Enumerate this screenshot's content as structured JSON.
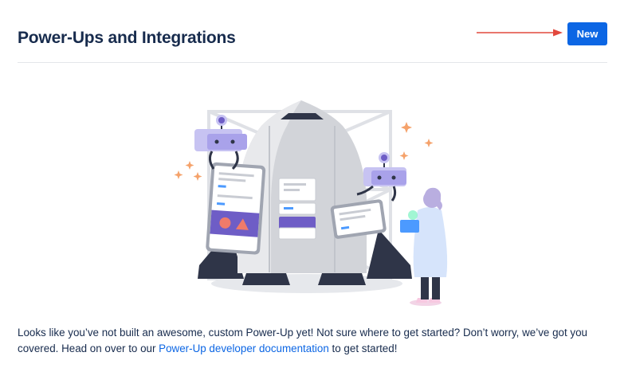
{
  "header": {
    "title": "Power-Ups and Integrations",
    "new_button_label": "New"
  },
  "colors": {
    "primary": "#0c66e4",
    "title_text": "#172b4d",
    "annotation_arrow": "#e2483d",
    "illustration_accent": "#6e5dc6"
  },
  "illustration": {
    "icon": "rocket-launch-illustration"
  },
  "empty_state": {
    "message_before_link": "Looks like you’ve not built an awesome, custom Power-Up yet! Not sure where to get started? Don’t worry, we’ve got you covered. Head on over to our ",
    "link_text": "Power-Up developer documentation",
    "message_after_link": " to get started!"
  }
}
